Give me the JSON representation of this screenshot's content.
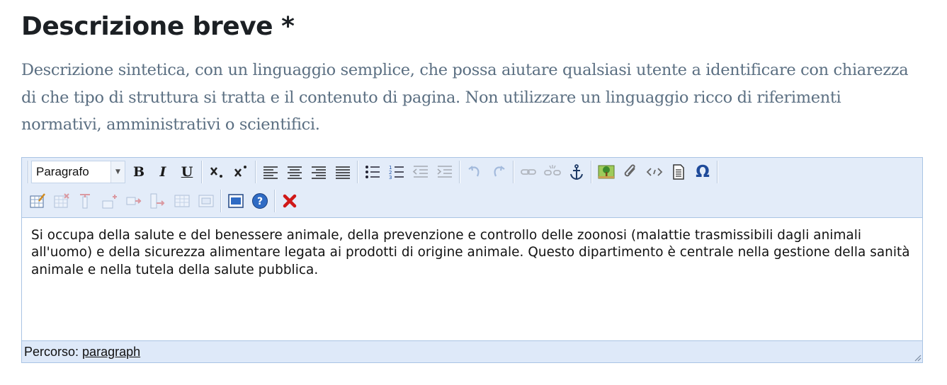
{
  "field": {
    "title": "Descrizione breve *",
    "help": "Descrizione sintetica, con un linguaggio semplice, che possa aiutare qualsiasi utente a identificare con chiarezza di che tipo di struttura si tratta e il contenuto di pagina. Non utilizzare un linguaggio ricco di riferimenti normativi, amministrativi o scientifici."
  },
  "editor": {
    "format_select": {
      "value": "Paragrafo"
    },
    "toolbar_row1": [
      {
        "name": "bold-icon",
        "enabled": true
      },
      {
        "name": "italic-icon",
        "enabled": true
      },
      {
        "name": "underline-icon",
        "enabled": true
      },
      {
        "name": "subscript-icon",
        "enabled": true
      },
      {
        "name": "superscript-icon",
        "enabled": true
      },
      {
        "name": "align-left-icon",
        "enabled": true
      },
      {
        "name": "align-center-icon",
        "enabled": true
      },
      {
        "name": "align-right-icon",
        "enabled": true
      },
      {
        "name": "align-justify-icon",
        "enabled": true
      },
      {
        "name": "bullet-list-icon",
        "enabled": true
      },
      {
        "name": "numbered-list-icon",
        "enabled": true
      },
      {
        "name": "outdent-icon",
        "enabled": false
      },
      {
        "name": "indent-icon",
        "enabled": false
      },
      {
        "name": "undo-icon",
        "enabled": false
      },
      {
        "name": "redo-icon",
        "enabled": false
      },
      {
        "name": "link-icon",
        "enabled": false
      },
      {
        "name": "unlink-icon",
        "enabled": false
      },
      {
        "name": "anchor-icon",
        "enabled": true
      },
      {
        "name": "image-icon",
        "enabled": true
      },
      {
        "name": "attachment-icon",
        "enabled": true
      },
      {
        "name": "html-source-icon",
        "enabled": true
      },
      {
        "name": "paste-text-icon",
        "enabled": true
      },
      {
        "name": "special-char-icon",
        "enabled": true
      }
    ],
    "toolbar_row2": [
      {
        "name": "table-insert-icon",
        "enabled": true
      },
      {
        "name": "table-delete-icon",
        "enabled": false
      },
      {
        "name": "table-col-icon",
        "enabled": false
      },
      {
        "name": "table-row-icon",
        "enabled": false
      },
      {
        "name": "table-split-icon",
        "enabled": false
      },
      {
        "name": "table-merge-icon",
        "enabled": false
      },
      {
        "name": "table-props-icon",
        "enabled": false
      },
      {
        "name": "table-cell-icon",
        "enabled": false
      },
      {
        "name": "fullscreen-icon",
        "enabled": true
      },
      {
        "name": "help-icon",
        "enabled": true
      },
      {
        "name": "close-icon",
        "enabled": true
      }
    ],
    "glyphs": {
      "bold": "B",
      "italic": "I",
      "underline": "U",
      "omega": "Ω"
    },
    "content": "Si occupa della salute e del benessere animale, della prevenzione e controllo delle zoonosi (malattie trasmissibili dagli animali all'uomo) e della sicurezza alimentare legata ai prodotti di origine animale. Questo dipartimento è centrale nella gestione della sanità animale e nella tutela della salute pubblica.",
    "status": {
      "label": "Percorso:",
      "path": "paragraph"
    }
  },
  "colors": {
    "title": "#1c2024",
    "help": "#5b6f82",
    "toolbar_bg": "#e3ecf9",
    "border": "#a9c4e4",
    "close_red": "#d01818"
  }
}
